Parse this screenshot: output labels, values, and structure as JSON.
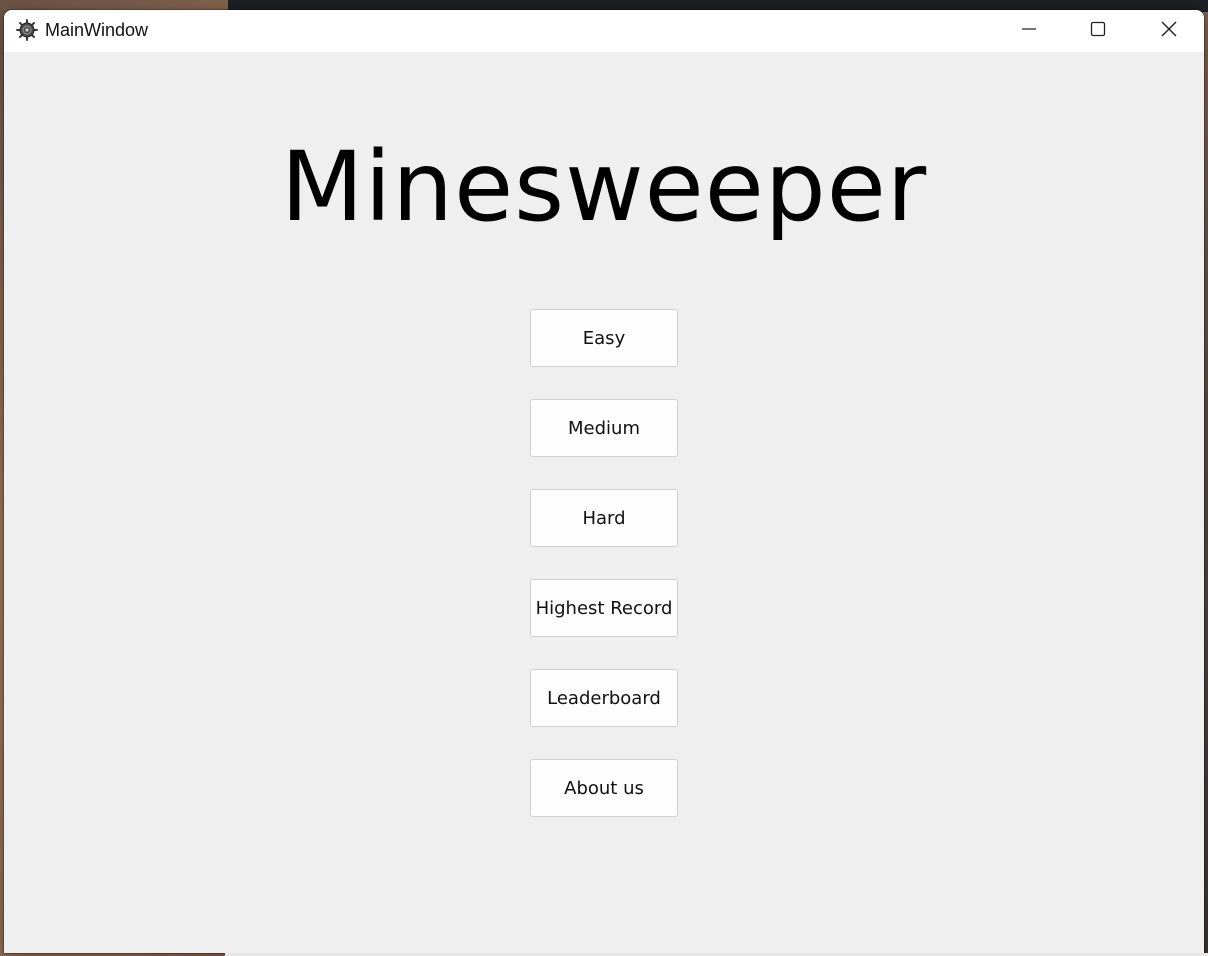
{
  "window": {
    "title": "MainWindow",
    "app_icon": "mine-icon",
    "controls": {
      "minimize_icon": "minimize-icon",
      "maximize_icon": "maximize-icon",
      "close_icon": "close-icon"
    }
  },
  "main": {
    "heading": "Minesweeper",
    "buttons": [
      {
        "label": "Easy"
      },
      {
        "label": "Medium"
      },
      {
        "label": "Hard"
      },
      {
        "label": "Highest Record"
      },
      {
        "label": "Leaderboard"
      },
      {
        "label": "About us"
      }
    ]
  }
}
